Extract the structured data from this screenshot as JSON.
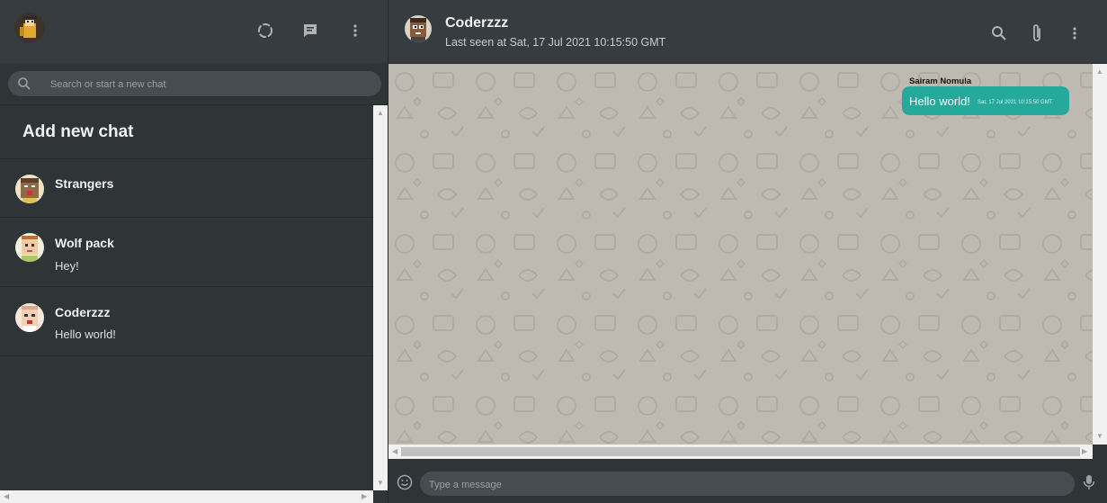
{
  "sidebar": {
    "search": {
      "placeholder": "Search or start a new chat"
    },
    "add_new_chat_label": "Add new chat",
    "chats": [
      {
        "name": "Strangers",
        "last_message": ""
      },
      {
        "name": "Wolf pack",
        "last_message": "Hey!"
      },
      {
        "name": "Coderzzz",
        "last_message": "Hello world!"
      }
    ]
  },
  "chat": {
    "name": "Coderzzz",
    "last_seen": "Last seen at Sat, 17 Jul 2021 10:15:50 GMT",
    "messages": [
      {
        "sender": "Sairam Nomula",
        "text": "Hello world!",
        "timestamp": "Sat, 17 Jul 2021 10:15:50 GMT"
      }
    ],
    "composer": {
      "placeholder": "Type a message"
    }
  },
  "icons": {
    "status": "status-icon",
    "new_chat": "message-icon",
    "menu": "more-vertical-icon",
    "search": "search-icon",
    "attach": "paperclip-icon",
    "emoji": "emoji-icon",
    "mic": "mic-icon"
  },
  "colors": {
    "panel": "#2f3437",
    "header": "#373c40",
    "accent_bubble": "#25a99b",
    "wallpaper": "#bfbab1"
  }
}
